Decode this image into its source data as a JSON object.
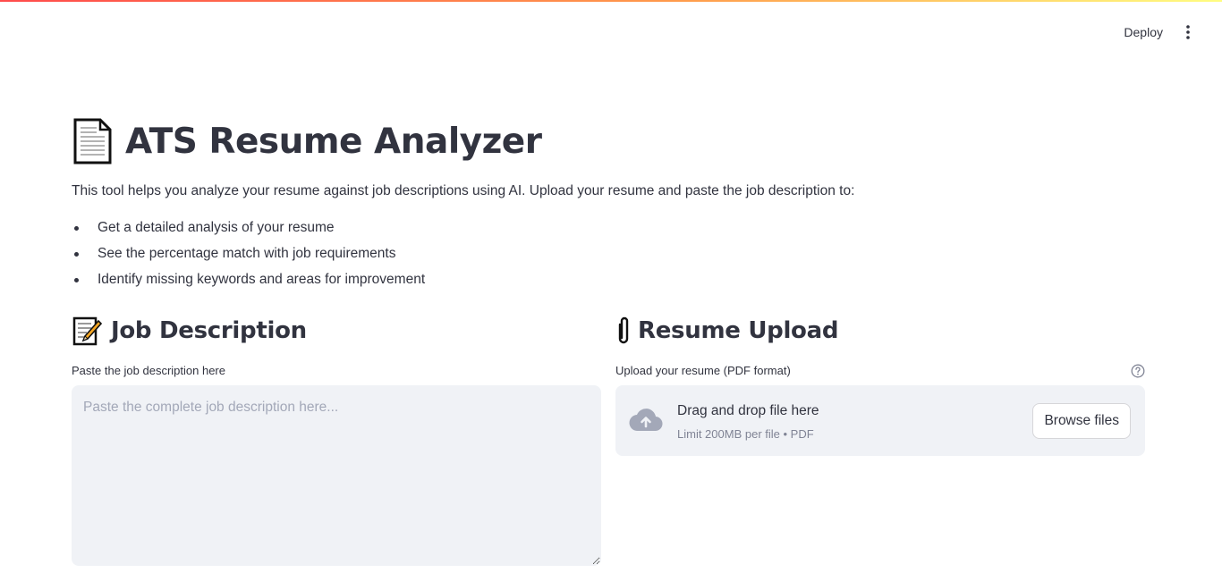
{
  "header": {
    "deploy_label": "Deploy"
  },
  "title": {
    "text": "ATS Resume Analyzer",
    "icon": "page-facing-up-icon"
  },
  "intro": {
    "text": "This tool helps you analyze your resume against job descriptions using AI. Upload your resume and paste the job description to:",
    "items": [
      "Get a detailed analysis of your resume",
      "See the percentage match with job requirements",
      "Identify missing keywords and areas for improvement"
    ]
  },
  "job_description": {
    "heading": "Job Description",
    "icon": "memo-icon",
    "label": "Paste the job description here",
    "placeholder": "Paste the complete job description here...",
    "value": ""
  },
  "resume_upload": {
    "heading": "Resume Upload",
    "icon": "paperclip-icon",
    "label": "Upload your resume (PDF format)",
    "dropzone_title": "Drag and drop file here",
    "dropzone_sub": "Limit 200MB per file • PDF",
    "browse_label": "Browse files"
  },
  "colors": {
    "accent": "#ff4b4b",
    "text": "#31333f",
    "input_bg": "#f0f2f6",
    "muted": "#808495"
  }
}
